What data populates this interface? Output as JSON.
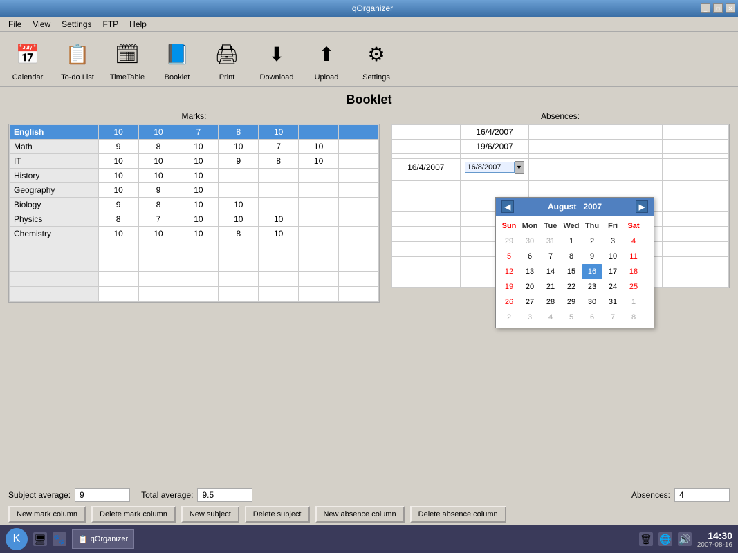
{
  "window": {
    "title": "qOrganizer",
    "controls": [
      "_",
      "□",
      "✕"
    ]
  },
  "menu": {
    "items": [
      "File",
      "View",
      "Settings",
      "FTP",
      "Help"
    ]
  },
  "toolbar": {
    "items": [
      {
        "id": "calendar",
        "label": "Calendar",
        "icon": "📅"
      },
      {
        "id": "todo",
        "label": "To-do List",
        "icon": "📋"
      },
      {
        "id": "timetable",
        "label": "TimeTable",
        "icon": "🗓"
      },
      {
        "id": "booklet",
        "label": "Booklet",
        "icon": "📘"
      },
      {
        "id": "print",
        "label": "Print",
        "icon": "🖨"
      },
      {
        "id": "download",
        "label": "Download",
        "icon": "⬇"
      },
      {
        "id": "upload",
        "label": "Upload",
        "icon": "⬆"
      },
      {
        "id": "settings",
        "label": "Settings",
        "icon": "⚙"
      }
    ]
  },
  "page": {
    "title": "Booklet",
    "marks_label": "Marks:",
    "absences_label": "Absences:"
  },
  "marks": {
    "subjects": [
      {
        "name": "English",
        "marks": [
          "10",
          "10",
          "7",
          "8",
          "10",
          "",
          ""
        ],
        "selected": true
      },
      {
        "name": "Math",
        "marks": [
          "9",
          "8",
          "10",
          "10",
          "7",
          "10",
          ""
        ]
      },
      {
        "name": "IT",
        "marks": [
          "10",
          "10",
          "10",
          "9",
          "8",
          "10",
          ""
        ]
      },
      {
        "name": "History",
        "marks": [
          "10",
          "10",
          "10",
          "",
          "",
          "",
          ""
        ]
      },
      {
        "name": "Geography",
        "marks": [
          "10",
          "9",
          "10",
          "",
          "",
          "",
          ""
        ]
      },
      {
        "name": "Biology",
        "marks": [
          "9",
          "8",
          "10",
          "10",
          "",
          "",
          ""
        ]
      },
      {
        "name": "Physics",
        "marks": [
          "8",
          "7",
          "10",
          "10",
          "10",
          "",
          ""
        ]
      },
      {
        "name": "Chemistry",
        "marks": [
          "10",
          "10",
          "10",
          "8",
          "10",
          "",
          ""
        ]
      }
    ],
    "empty_rows": 4
  },
  "absences": {
    "rows": [
      {
        "col1": "",
        "col2": "16/4/2007",
        "col3": "",
        "col4": ""
      },
      {
        "col1": "",
        "col2": "19/6/2007",
        "col3": "",
        "col4": ""
      },
      {
        "col1": "",
        "col2": "",
        "col3": "",
        "col4": ""
      },
      {
        "col1": "16/4/2007",
        "col2": "16/8/2007",
        "col3": "",
        "col4": "",
        "has_input": true
      },
      {
        "col1": "",
        "col2": "",
        "col3": "",
        "col4": ""
      },
      {
        "col1": "",
        "col2": "",
        "col3": "",
        "col4": ""
      },
      {
        "col1": "",
        "col2": "",
        "col3": "",
        "col4": ""
      },
      {
        "col1": "",
        "col2": "",
        "col3": "",
        "col4": ""
      },
      {
        "col1": "",
        "col2": "",
        "col3": "",
        "col4": ""
      },
      {
        "col1": "",
        "col2": "",
        "col3": "",
        "col4": ""
      },
      {
        "col1": "",
        "col2": "",
        "col3": "",
        "col4": ""
      },
      {
        "col1": "",
        "col2": "",
        "col3": "",
        "col4": ""
      }
    ]
  },
  "calendar": {
    "month": "August",
    "year": "2007",
    "headers": [
      "Sun",
      "Mon",
      "Tue",
      "Wed",
      "Thu",
      "Fri",
      "Sat"
    ],
    "weeks": [
      [
        "29",
        "30",
        "31",
        "1",
        "2",
        "3",
        "4"
      ],
      [
        "5",
        "6",
        "7",
        "8",
        "9",
        "10",
        "11"
      ],
      [
        "12",
        "13",
        "14",
        "15",
        "16",
        "17",
        "18"
      ],
      [
        "19",
        "20",
        "21",
        "22",
        "23",
        "24",
        "25"
      ],
      [
        "26",
        "27",
        "28",
        "29",
        "30",
        "31",
        "1"
      ],
      [
        "2",
        "3",
        "4",
        "5",
        "6",
        "7",
        "8"
      ]
    ],
    "other_month_days": [
      "29",
      "30",
      "31",
      "1",
      "2",
      "3",
      "4",
      "5",
      "6",
      "7",
      "8"
    ],
    "selected_day": "16",
    "date_input_value": "16/8/2007"
  },
  "stats": {
    "subject_average_label": "Subject average:",
    "subject_average_value": "9",
    "total_average_label": "Total average:",
    "total_average_value": "9.5",
    "absences_label": "Absences:",
    "absences_value": "4"
  },
  "buttons": {
    "new_mark_column": "New mark column",
    "delete_mark_column": "Delete mark column",
    "new_subject": "New subject",
    "delete_subject": "Delete subject",
    "new_absence_column": "New absence column",
    "delete_absence_column": "Delete absence column"
  },
  "taskbar": {
    "app_name": "qOrganizer",
    "time": "14:30",
    "date": "2007-08-16"
  }
}
